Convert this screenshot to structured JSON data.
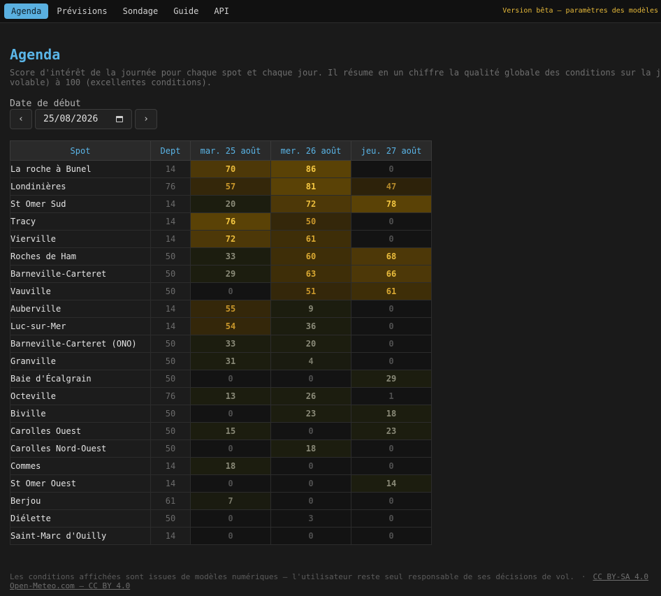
{
  "nav": {
    "items": [
      {
        "label": "Agenda",
        "active": true
      },
      {
        "label": "Prévisions",
        "active": false
      },
      {
        "label": "Sondage",
        "active": false
      },
      {
        "label": "Guide",
        "active": false
      },
      {
        "label": "API",
        "active": false
      }
    ],
    "beta_notice": "Version bêta — paramètres des modèles"
  },
  "page": {
    "title": "Agenda",
    "description_line1": "Score d'intérêt de la journée pour chaque spot et chaque jour. Il résume en un chiffre la qualité globale des conditions sur la j",
    "description_line2": "volable) à 100 (excellentes conditions)."
  },
  "date_picker": {
    "label": "Date de début",
    "value": "25/08/2026",
    "prev": "‹",
    "next": "›"
  },
  "table": {
    "headers": {
      "spot": "Spot",
      "dept": "Dept",
      "days": [
        "mar. 25 août",
        "mer. 26 août",
        "jeu. 27 août"
      ]
    },
    "rows": [
      {
        "spot": "La roche à Bunel",
        "dept": "14",
        "scores": [
          70,
          86,
          0
        ]
      },
      {
        "spot": "Londinières",
        "dept": "76",
        "scores": [
          57,
          81,
          47
        ]
      },
      {
        "spot": "St Omer Sud",
        "dept": "14",
        "scores": [
          20,
          72,
          78
        ]
      },
      {
        "spot": "Tracy",
        "dept": "14",
        "scores": [
          76,
          50,
          0
        ]
      },
      {
        "spot": "Vierville",
        "dept": "14",
        "scores": [
          72,
          61,
          0
        ]
      },
      {
        "spot": "Roches de Ham",
        "dept": "50",
        "scores": [
          33,
          60,
          68
        ]
      },
      {
        "spot": "Barneville-Carteret",
        "dept": "50",
        "scores": [
          29,
          63,
          66
        ]
      },
      {
        "spot": "Vauville",
        "dept": "50",
        "scores": [
          0,
          51,
          61
        ]
      },
      {
        "spot": "Auberville",
        "dept": "14",
        "scores": [
          55,
          9,
          0
        ]
      },
      {
        "spot": "Luc-sur-Mer",
        "dept": "14",
        "scores": [
          54,
          36,
          0
        ]
      },
      {
        "spot": "Barneville-Carteret (ONO)",
        "dept": "50",
        "scores": [
          33,
          20,
          0
        ]
      },
      {
        "spot": "Granville",
        "dept": "50",
        "scores": [
          31,
          4,
          0
        ]
      },
      {
        "spot": "Baie d'Écalgrain",
        "dept": "50",
        "scores": [
          0,
          0,
          29
        ]
      },
      {
        "spot": "Octeville",
        "dept": "76",
        "scores": [
          13,
          26,
          1
        ]
      },
      {
        "spot": "Biville",
        "dept": "50",
        "scores": [
          0,
          23,
          18
        ]
      },
      {
        "spot": "Carolles Ouest",
        "dept": "50",
        "scores": [
          15,
          0,
          23
        ]
      },
      {
        "spot": "Carolles Nord-Ouest",
        "dept": "50",
        "scores": [
          0,
          18,
          0
        ]
      },
      {
        "spot": "Commes",
        "dept": "14",
        "scores": [
          18,
          0,
          0
        ]
      },
      {
        "spot": "St Omer Ouest",
        "dept": "14",
        "scores": [
          0,
          0,
          14
        ]
      },
      {
        "spot": "Berjou",
        "dept": "61",
        "scores": [
          7,
          0,
          0
        ]
      },
      {
        "spot": "Diélette",
        "dept": "50",
        "scores": [
          0,
          3,
          0
        ]
      },
      {
        "spot": "Saint-Marc d'Ouilly",
        "dept": "14",
        "scores": [
          0,
          0,
          0
        ]
      }
    ]
  },
  "footer": {
    "disclaimer": "Les conditions affichées sont issues de modèles numériques — l'utilisateur reste seul responsable de ses décisions de vol.",
    "separator": "·",
    "license": "CC BY-SA 4.0",
    "source": "Open-Meteo.com — CC BY 4.0"
  },
  "colors": {
    "accent": "#5ab4e6",
    "active_tab": "#5ab0e0",
    "beta": "#e6b93a",
    "score_high": "#f0c040"
  }
}
